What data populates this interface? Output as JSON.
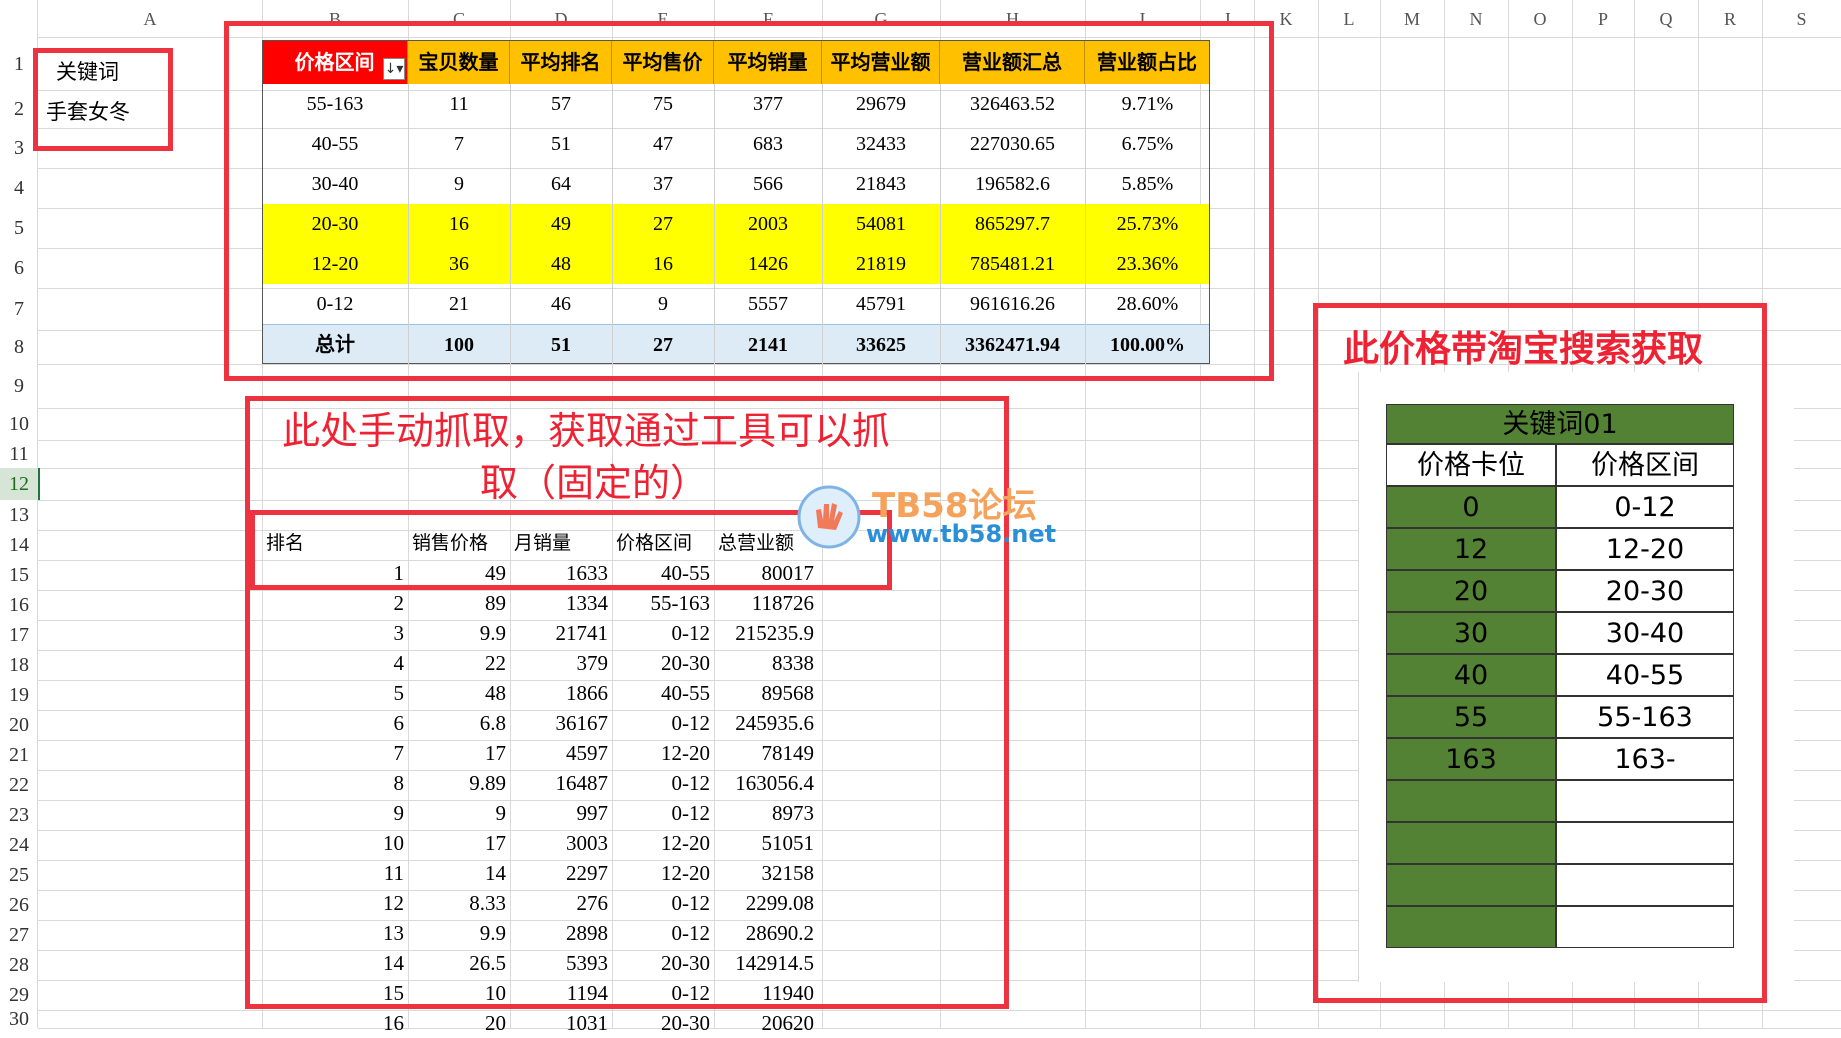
{
  "sheet": {
    "columns": [
      "A",
      "B",
      "C",
      "D",
      "E",
      "F",
      "G",
      "H",
      "I",
      "J",
      "K",
      "L",
      "M",
      "N",
      "O",
      "P",
      "Q",
      "R",
      "S"
    ],
    "rows": [
      "1",
      "2",
      "3",
      "4",
      "5",
      "6",
      "7",
      "8",
      "9",
      "10",
      "11",
      "12",
      "13",
      "14",
      "15",
      "16",
      "17",
      "18",
      "19",
      "20",
      "21",
      "22",
      "23",
      "24",
      "25",
      "26",
      "27",
      "28",
      "29",
      "30"
    ],
    "selected_row": "12"
  },
  "keyword": {
    "label": "关键词",
    "value": "手套女冬"
  },
  "pivot": {
    "headers": [
      "价格区间",
      "宝贝数量",
      "平均排名",
      "平均售价",
      "平均销量",
      "平均营业额",
      "营业额汇总",
      "营业额占比"
    ],
    "rows": [
      [
        "55-163",
        "11",
        "57",
        "75",
        "377",
        "29679",
        "326463.52",
        "9.71%"
      ],
      [
        "40-55",
        "7",
        "51",
        "47",
        "683",
        "32433",
        "227030.65",
        "6.75%"
      ],
      [
        "30-40",
        "9",
        "64",
        "37",
        "566",
        "21843",
        "196582.6",
        "5.85%"
      ],
      [
        "20-30",
        "16",
        "49",
        "27",
        "2003",
        "54081",
        "865297.7",
        "25.73%"
      ],
      [
        "12-20",
        "36",
        "48",
        "16",
        "1426",
        "21819",
        "785481.21",
        "23.36%"
      ],
      [
        "0-12",
        "21",
        "46",
        "9",
        "5557",
        "45791",
        "961616.26",
        "28.60%"
      ]
    ],
    "total": [
      "总计",
      "100",
      "51",
      "27",
      "2141",
      "33625",
      "3362471.94",
      "100.00%"
    ],
    "highlight_color": "#ffff00",
    "header_color": "#ffc000",
    "first_header_color": "#ff0000"
  },
  "annotations": {
    "manual_line1": "此处手动抓取，获取通过工具可以抓",
    "manual_line2": "取（固定的）",
    "price_band": "此价格带淘宝搜索获取"
  },
  "watermark": {
    "title": "TB58论坛",
    "url": "www.tb58.net"
  },
  "list": {
    "headers": [
      "排名",
      "销售价格",
      "月销量",
      "价格区间",
      "总营业额"
    ],
    "rows": [
      [
        "1",
        "49",
        "1633",
        "40-55",
        "80017"
      ],
      [
        "2",
        "89",
        "1334",
        "55-163",
        "118726"
      ],
      [
        "3",
        "9.9",
        "21741",
        "0-12",
        "215235.9"
      ],
      [
        "4",
        "22",
        "379",
        "20-30",
        "8338"
      ],
      [
        "5",
        "48",
        "1866",
        "40-55",
        "89568"
      ],
      [
        "6",
        "6.8",
        "36167",
        "0-12",
        "245935.6"
      ],
      [
        "7",
        "17",
        "4597",
        "12-20",
        "78149"
      ],
      [
        "8",
        "9.89",
        "16487",
        "0-12",
        "163056.4"
      ],
      [
        "9",
        "9",
        "997",
        "0-12",
        "8973"
      ],
      [
        "10",
        "17",
        "3003",
        "12-20",
        "51051"
      ],
      [
        "11",
        "14",
        "2297",
        "12-20",
        "32158"
      ],
      [
        "12",
        "8.33",
        "276",
        "0-12",
        "2299.08"
      ],
      [
        "13",
        "9.9",
        "2898",
        "0-12",
        "28690.2"
      ],
      [
        "14",
        "26.5",
        "5393",
        "20-30",
        "142914.5"
      ],
      [
        "15",
        "10",
        "1194",
        "0-12",
        "11940"
      ],
      [
        "16",
        "20",
        "1031",
        "20-30",
        "20620"
      ]
    ]
  },
  "price_table": {
    "title": "关键词01",
    "headers": [
      "价格卡位",
      "价格区间"
    ],
    "rows": [
      [
        "0",
        "0-12"
      ],
      [
        "12",
        "12-20"
      ],
      [
        "20",
        "20-30"
      ],
      [
        "30",
        "30-40"
      ],
      [
        "40",
        "40-55"
      ],
      [
        "55",
        "55-163"
      ],
      [
        "163",
        "163-"
      ],
      [
        "",
        ""
      ],
      [
        "",
        ""
      ],
      [
        "",
        ""
      ],
      [
        "",
        ""
      ]
    ],
    "green_color": "#548235"
  }
}
